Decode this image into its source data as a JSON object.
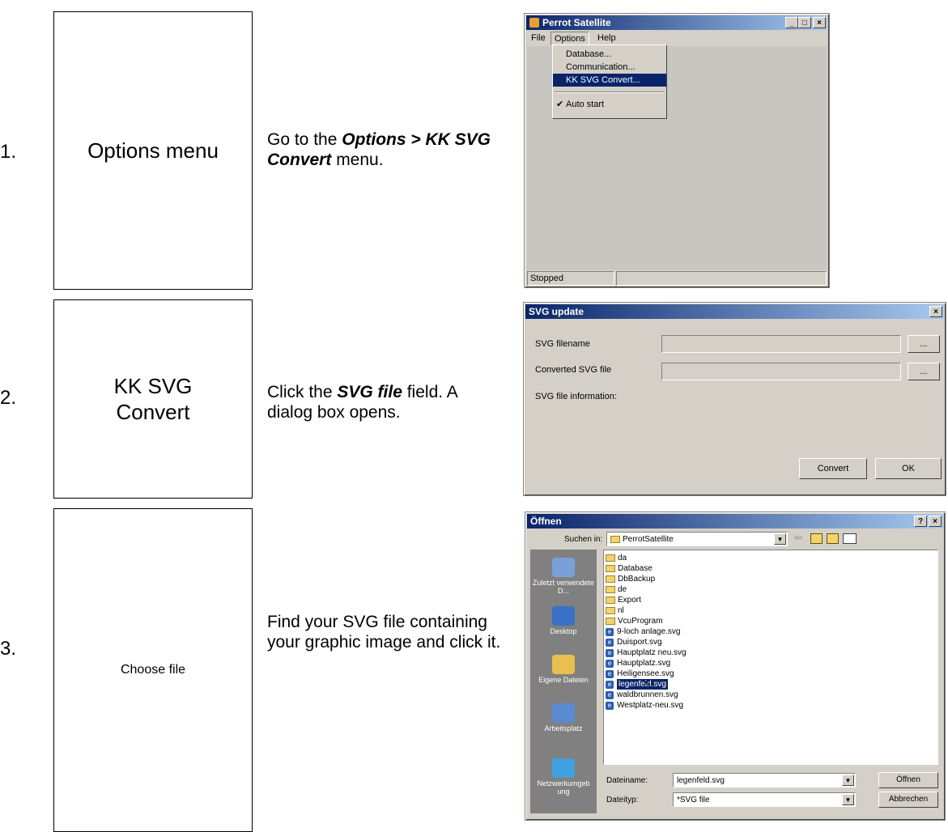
{
  "steps": [
    {
      "number": "1.",
      "box": "Options menu",
      "desc_prefix": "Go to the ",
      "desc_bold": "Options > KK SVG Convert",
      "desc_suffix": " menu."
    },
    {
      "number": "2.",
      "box": "KK SVG Convert",
      "desc_prefix": "Click the ",
      "desc_bold": "SVG file",
      "desc_suffix": " field. A dialog box opens."
    },
    {
      "number": "3.",
      "box": "Choose file",
      "desc_text": "Find your SVG file containing your graphic image and click it."
    }
  ],
  "win1": {
    "title": "Perrot Satellite",
    "menubar": [
      "File",
      "Options",
      "Help"
    ],
    "options_menu": [
      "Database...",
      "Communication...",
      "KK SVG Convert...",
      "Auto start"
    ],
    "status": "Stopped"
  },
  "win2": {
    "title": "SVG update",
    "label_filename": "SVG filename",
    "label_converted": "Converted SVG file",
    "label_info": "SVG file information:",
    "browse": "...",
    "convert": "Convert",
    "ok": "OK"
  },
  "win3": {
    "title": "Öffnen",
    "help": "?",
    "lookin_label": "Suchen in:",
    "lookin_value": "PerrotSatellite",
    "places": [
      "Zuletzt verwendete D...",
      "Desktop",
      "Eigene Dateien",
      "Arbeitsplatz",
      "Netzwerkumgeb ung"
    ],
    "folders": [
      "da",
      "Database",
      "DbBackup",
      "de",
      "Export",
      "nl",
      "VcuProgram"
    ],
    "files": [
      "9-loch anlage.svg",
      "Duisport.svg",
      "Hauptplatz neu.svg",
      "Hauptplatz.svg",
      "Heiligensee.svg",
      "legenfeld.svg",
      "waldbrunnen.svg",
      "Westplatz-neu.svg"
    ],
    "filename_label": "Dateiname:",
    "filename_value": "legenfeld.svg",
    "filetype_label": "Dateityp:",
    "filetype_value": "*SVG file",
    "open_button": "Öffnen",
    "cancel_button": "Abbrechen"
  },
  "colors": {
    "titlebar": "#0a246a",
    "face": "#d4d0c8",
    "selection": "#0a246a"
  }
}
